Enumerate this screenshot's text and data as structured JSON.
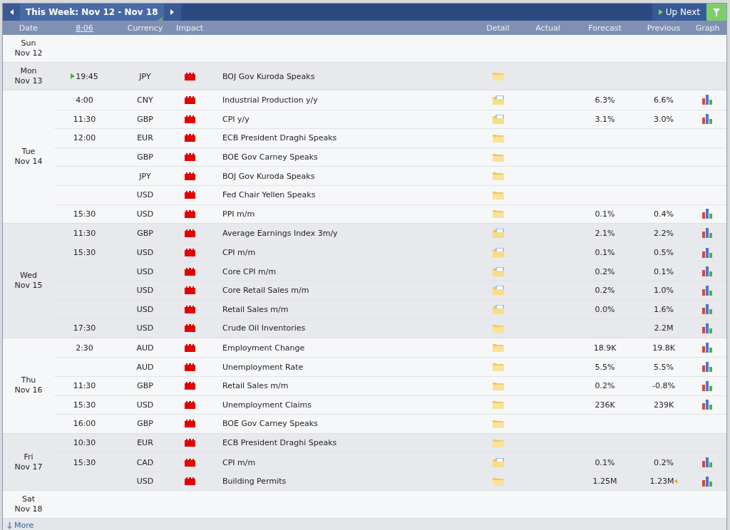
{
  "toolbar": {
    "week_label": "This Week: Nov 12 - Nov 18",
    "up_next": "Up Next"
  },
  "columns": {
    "date": "Date",
    "time": "8:06",
    "currency": "Currency",
    "impact": "Impact",
    "detail": "Detail",
    "actual": "Actual",
    "forecast": "Forecast",
    "previous": "Previous",
    "graph": "Graph"
  },
  "days": [
    {
      "day": "Sun",
      "date": "Nov 12"
    },
    {
      "day": "Mon",
      "date": "Nov 13",
      "events": [
        {
          "time": "19:45",
          "next": true,
          "currency": "JPY",
          "title": "BOJ Gov Kuroda Speaks",
          "detail_data": false,
          "graph": false
        }
      ]
    },
    {
      "day": "Tue",
      "date": "Nov 14",
      "events": [
        {
          "time": "4:00",
          "next": false,
          "currency": "CNY",
          "title": "Industrial Production y/y",
          "detail_data": true,
          "forecast": "6.3%",
          "previous": "6.6%",
          "graph": true
        },
        {
          "time": "11:30",
          "next": false,
          "currency": "GBP",
          "title": "CPI y/y",
          "detail_data": true,
          "forecast": "3.1%",
          "previous": "3.0%",
          "graph": true
        },
        {
          "time": "12:00",
          "next": false,
          "currency": "EUR",
          "title": "ECB President Draghi Speaks",
          "detail_data": false,
          "graph": false
        },
        {
          "next": false,
          "currency": "GBP",
          "title": "BOE Gov Carney Speaks",
          "detail_data": false,
          "graph": false
        },
        {
          "next": false,
          "currency": "JPY",
          "title": "BOJ Gov Kuroda Speaks",
          "detail_data": false,
          "graph": false
        },
        {
          "next": false,
          "currency": "USD",
          "title": "Fed Chair Yellen Speaks",
          "detail_data": false,
          "graph": false
        },
        {
          "time": "15:30",
          "next": false,
          "currency": "USD",
          "title": "PPI m/m",
          "detail_data": false,
          "forecast": "0.1%",
          "previous": "0.4%",
          "graph": true
        }
      ]
    },
    {
      "day": "Wed",
      "date": "Nov 15",
      "events": [
        {
          "time": "11:30",
          "next": false,
          "currency": "GBP",
          "title": "Average Earnings Index 3m/y",
          "detail_data": true,
          "forecast": "2.1%",
          "previous": "2.2%",
          "graph": true
        },
        {
          "time": "15:30",
          "next": false,
          "currency": "USD",
          "title": "CPI m/m",
          "detail_data": true,
          "forecast": "0.1%",
          "previous": "0.5%",
          "graph": true
        },
        {
          "next": false,
          "currency": "USD",
          "title": "Core CPI m/m",
          "detail_data": true,
          "forecast": "0.2%",
          "previous": "0.1%",
          "graph": true
        },
        {
          "next": false,
          "currency": "USD",
          "title": "Core Retail Sales m/m",
          "detail_data": true,
          "forecast": "0.2%",
          "previous": "1.0%",
          "graph": true
        },
        {
          "next": false,
          "currency": "USD",
          "title": "Retail Sales m/m",
          "detail_data": true,
          "forecast": "0.0%",
          "previous": "1.6%",
          "graph": true
        },
        {
          "time": "17:30",
          "next": false,
          "currency": "USD",
          "title": "Crude Oil Inventories",
          "detail_data": false,
          "previous": "2.2M",
          "graph": true
        }
      ]
    },
    {
      "day": "Thu",
      "date": "Nov 16",
      "events": [
        {
          "time": "2:30",
          "next": false,
          "currency": "AUD",
          "title": "Employment Change",
          "detail_data": false,
          "forecast": "18.9K",
          "previous": "19.8K",
          "graph": true
        },
        {
          "next": false,
          "currency": "AUD",
          "title": "Unemployment Rate",
          "detail_data": false,
          "forecast": "5.5%",
          "previous": "5.5%",
          "graph": true
        },
        {
          "time": "11:30",
          "next": false,
          "currency": "GBP",
          "title": "Retail Sales m/m",
          "detail_data": false,
          "forecast": "0.2%",
          "previous": "-0.8%",
          "graph": true
        },
        {
          "time": "15:30",
          "next": false,
          "currency": "USD",
          "title": "Unemployment Claims",
          "detail_data": false,
          "forecast": "236K",
          "previous": "239K",
          "graph": true
        },
        {
          "time": "16:00",
          "next": false,
          "currency": "GBP",
          "title": "BOE Gov Carney Speaks",
          "detail_data": false,
          "graph": false
        }
      ]
    },
    {
      "day": "Fri",
      "date": "Nov 17",
      "events": [
        {
          "time": "10:30",
          "next": false,
          "currency": "EUR",
          "title": "ECB President Draghi Speaks",
          "detail_data": false,
          "graph": false
        },
        {
          "time": "15:30",
          "next": false,
          "currency": "CAD",
          "title": "CPI m/m",
          "detail_data": true,
          "forecast": "0.1%",
          "previous": "0.2%",
          "graph": true
        },
        {
          "next": false,
          "currency": "USD",
          "title": "Building Permits",
          "detail_data": false,
          "forecast": "1.25M",
          "previous": "1.23M",
          "revised": true,
          "graph": true
        }
      ]
    },
    {
      "day": "Sat",
      "date": "Nov 18"
    }
  ],
  "more": "More"
}
